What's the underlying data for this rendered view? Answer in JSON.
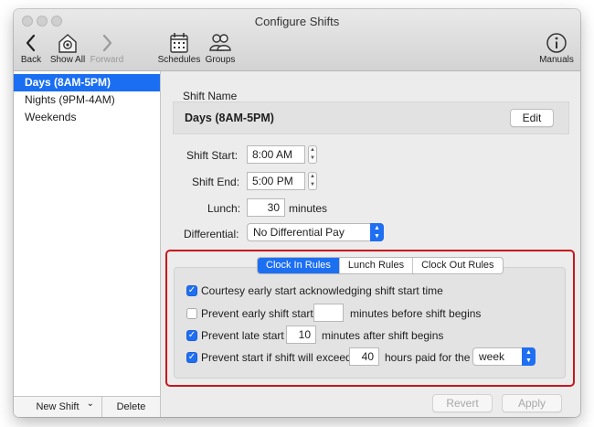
{
  "window": {
    "title": "Configure Shifts"
  },
  "toolbar": {
    "back": "Back",
    "show_all": "Show All",
    "forward": "Forward",
    "schedules": "Schedules",
    "groups": "Groups",
    "manuals": "Manuals"
  },
  "sidebar": {
    "items": [
      {
        "label": "Days (8AM-5PM)",
        "selected": true
      },
      {
        "label": "Nights (9PM-4AM)",
        "selected": false
      },
      {
        "label": "Weekends",
        "selected": false
      }
    ],
    "new_shift": "New Shift",
    "new_shift_arrow": "⌄",
    "delete": "Delete"
  },
  "shift": {
    "name_label": "Shift Name",
    "name_value": "Days (8AM-5PM)",
    "edit": "Edit",
    "start_label": "Shift Start:",
    "start_value": "8:00 AM",
    "end_label": "Shift End:",
    "end_value": "5:00 PM",
    "lunch_label": "Lunch:",
    "lunch_value": "30",
    "lunch_unit": "minutes",
    "differential_label": "Differential:",
    "differential_value": "No Differential Pay"
  },
  "rules": {
    "tabs": [
      {
        "label": "Clock In Rules",
        "active": true
      },
      {
        "label": "Lunch Rules",
        "active": false
      },
      {
        "label": "Clock Out Rules",
        "active": false
      }
    ],
    "courtesy": {
      "checked": true,
      "label": "Courtesy early start acknowledging shift start time"
    },
    "early": {
      "checked": false,
      "label": "Prevent early shift start",
      "value": "",
      "suffix": "minutes before shift begins"
    },
    "late": {
      "checked": true,
      "label": "Prevent late start",
      "value": "10",
      "suffix": "minutes after shift begins"
    },
    "exceed": {
      "checked": true,
      "label": "Prevent start if shift will exceed",
      "value": "40",
      "suffix": "hours paid for the",
      "period": "week"
    }
  },
  "footer": {
    "revert": "Revert",
    "apply": "Apply"
  },
  "colors": {
    "accent": "#1f6ff2",
    "highlight_border": "#c9161d"
  },
  "icons": [
    "back-icon",
    "show-all-icon",
    "forward-icon",
    "schedules-icon",
    "groups-icon",
    "manuals-icon"
  ]
}
